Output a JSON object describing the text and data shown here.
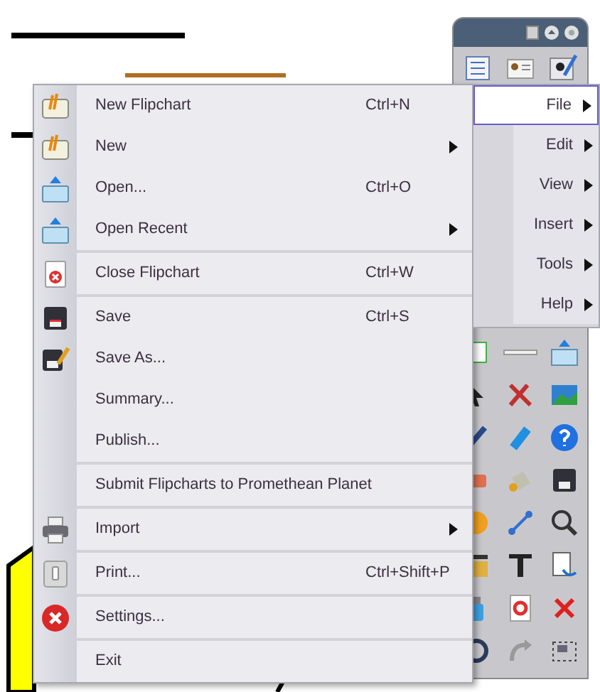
{
  "file_menu": {
    "groups": [
      [
        {
          "label": "New Flipchart",
          "shortcut": "Ctrl+N",
          "submenu": false
        },
        {
          "label": "New",
          "submenu": true
        },
        {
          "label": "Open...",
          "shortcut": "Ctrl+O",
          "submenu": false
        },
        {
          "label": "Open Recent",
          "submenu": true
        }
      ],
      [
        {
          "label": "Close Flipchart",
          "shortcut": "Ctrl+W",
          "submenu": false
        }
      ],
      [
        {
          "label": "Save",
          "shortcut": "Ctrl+S",
          "submenu": false
        },
        {
          "label": "Save As...",
          "submenu": false
        },
        {
          "label": "Summary...",
          "submenu": false
        },
        {
          "label": "Publish...",
          "submenu": false
        }
      ],
      [
        {
          "label": "Submit Flipcharts to Promethean Planet",
          "submenu": false
        }
      ],
      [
        {
          "label": "Import",
          "submenu": true
        }
      ],
      [
        {
          "label": "Print...",
          "shortcut": "Ctrl+Shift+P",
          "submenu": false
        }
      ],
      [
        {
          "label": "Settings...",
          "submenu": false
        }
      ],
      [
        {
          "label": "Exit",
          "submenu": false
        }
      ]
    ]
  },
  "main_menu": [
    {
      "label": "File",
      "selected": true
    },
    {
      "label": "Edit",
      "selected": false
    },
    {
      "label": "View",
      "selected": false
    },
    {
      "label": "Insert",
      "selected": false
    },
    {
      "label": "Tools",
      "selected": false
    },
    {
      "label": "Help",
      "selected": false
    }
  ]
}
